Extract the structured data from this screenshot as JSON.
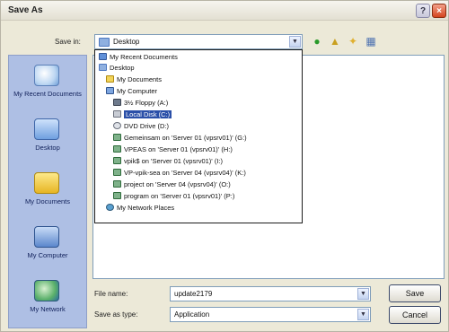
{
  "window": {
    "title": "Save As"
  },
  "titlebar": {
    "help_glyph": "?",
    "close_glyph": "×"
  },
  "save_in": {
    "label": "Save in:",
    "value": "Desktop"
  },
  "toolbar_icons": [
    "back-icon",
    "up-folder-icon",
    "new-folder-icon",
    "views-menu-icon"
  ],
  "places": [
    {
      "label": "My Recent Documents",
      "icon": "recent-documents-icon"
    },
    {
      "label": "Desktop",
      "icon": "desktop-icon"
    },
    {
      "label": "My Documents",
      "icon": "my-documents-icon"
    },
    {
      "label": "My Computer",
      "icon": "my-computer-icon"
    },
    {
      "label": "My Network",
      "icon": "network-places-icon"
    }
  ],
  "dropdown": {
    "items": [
      {
        "label": "My Recent Documents",
        "icon": "recent-documents-icon",
        "indent": 0
      },
      {
        "label": "Desktop",
        "icon": "desktop-icon",
        "indent": 0
      },
      {
        "label": "My Documents",
        "icon": "my-documents-icon",
        "indent": 1
      },
      {
        "label": "My Computer",
        "icon": "my-computer-icon",
        "indent": 1
      },
      {
        "label": "3½ Floppy (A:)",
        "icon": "floppy-drive-icon",
        "indent": 2
      },
      {
        "label": "Local Disk (C:)",
        "icon": "local-disk-icon",
        "indent": 2,
        "selected": true
      },
      {
        "label": "DVD Drive (D:)",
        "icon": "dvd-drive-icon",
        "indent": 2
      },
      {
        "label": "Gemeinsam on 'Server 01 (vpsrv01)' (G:)",
        "icon": "network-drive-icon",
        "indent": 2
      },
      {
        "label": "VPEAS on 'Server 01 (vpsrv01)' (H:)",
        "icon": "network-drive-icon",
        "indent": 2
      },
      {
        "label": "vpik$ on 'Server 01 (vpsrv01)' (I:)",
        "icon": "network-drive-icon",
        "indent": 2
      },
      {
        "label": "VP-vpik-sea on 'Server 04 (vpsrv04)' (K:)",
        "icon": "network-drive-icon",
        "indent": 2
      },
      {
        "label": "project on 'Server 04 (vpsrv04)' (O:)",
        "icon": "network-drive-icon",
        "indent": 2
      },
      {
        "label": "program on 'Server 01 (vpsrv01)' (P:)",
        "icon": "network-drive-icon",
        "indent": 2
      },
      {
        "label": "My Network Places",
        "icon": "network-places-icon",
        "indent": 1
      }
    ]
  },
  "file_name": {
    "label": "File name:",
    "value": "update2179"
  },
  "save_as_type": {
    "label": "Save as type:",
    "value": "Application"
  },
  "buttons": {
    "save": "Save",
    "cancel": "Cancel"
  }
}
